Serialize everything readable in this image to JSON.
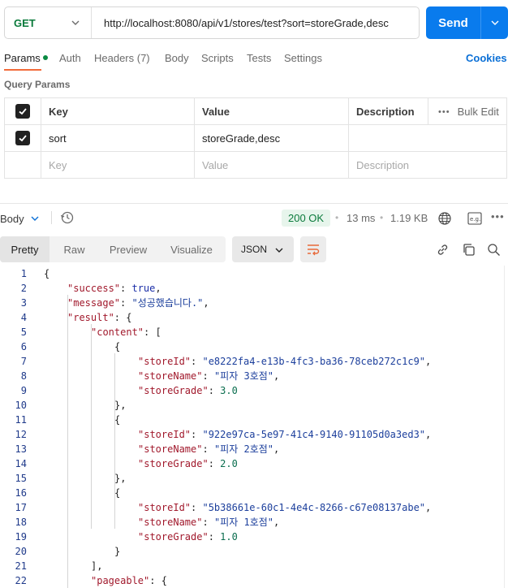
{
  "request": {
    "method": "GET",
    "url": "http://localhost:8080/api/v1/stores/test?sort=storeGrade,desc",
    "send_label": "Send"
  },
  "request_tabs": [
    "Params",
    "Auth",
    "Headers (7)",
    "Body",
    "Scripts",
    "Tests",
    "Settings"
  ],
  "cookies_label": "Cookies",
  "query_params": {
    "title": "Query Params",
    "headers": {
      "key": "Key",
      "value": "Value",
      "description": "Description",
      "bulk_edit": "Bulk Edit"
    },
    "rows": [
      {
        "key": "sort",
        "value": "storeGrade,desc",
        "description": ""
      }
    ],
    "placeholders": {
      "key": "Key",
      "value": "Value",
      "description": "Description"
    }
  },
  "response": {
    "body_label": "Body",
    "status": "200 OK",
    "time": "13 ms",
    "size": "1.19 KB",
    "format_tabs": [
      "Pretty",
      "Raw",
      "Preview",
      "Visualize"
    ],
    "format_selected": "JSON"
  },
  "icons": {
    "method_dropdown": "chevron-down-icon",
    "send_dropdown": "chevron-down-icon",
    "history": "history-icon",
    "globe": "globe-icon",
    "save_example": "save-example-icon",
    "more": "more-icon",
    "wrap": "wrap-lines-icon",
    "link": "link-icon",
    "copy": "copy-icon",
    "search": "search-icon"
  },
  "colors": {
    "send": "#097bed",
    "method_get": "#0a7a3b",
    "active_underline": "#f26b3a",
    "status_ok": "#0a7a3b",
    "json_key": "#a1192c",
    "json_string": "#1c3f9c",
    "json_number": "#0b6e4f"
  },
  "code_lines": [
    {
      "n": "1",
      "indent": 0,
      "t": [
        [
          "{",
          "p"
        ]
      ]
    },
    {
      "n": "2",
      "indent": 1,
      "t": [
        [
          "\"success\"",
          "k"
        ],
        [
          ": ",
          "p"
        ],
        [
          "true",
          "b"
        ],
        [
          ",",
          "p"
        ]
      ]
    },
    {
      "n": "3",
      "indent": 1,
      "t": [
        [
          "\"message\"",
          "k"
        ],
        [
          ": ",
          "p"
        ],
        [
          "\"성공했습니다.\"",
          "s"
        ],
        [
          ",",
          "p"
        ]
      ]
    },
    {
      "n": "4",
      "indent": 1,
      "t": [
        [
          "\"result\"",
          "k"
        ],
        [
          ": {",
          "p"
        ]
      ]
    },
    {
      "n": "5",
      "indent": 2,
      "t": [
        [
          "\"content\"",
          "k"
        ],
        [
          ": [",
          "p"
        ]
      ]
    },
    {
      "n": "6",
      "indent": 3,
      "t": [
        [
          "{",
          "p"
        ]
      ]
    },
    {
      "n": "7",
      "indent": 4,
      "t": [
        [
          "\"storeId\"",
          "k"
        ],
        [
          ": ",
          "p"
        ],
        [
          "\"e8222fa4-e13b-4fc3-ba36-78ceb272c1c9\"",
          "s"
        ],
        [
          ",",
          "p"
        ]
      ]
    },
    {
      "n": "8",
      "indent": 4,
      "t": [
        [
          "\"storeName\"",
          "k"
        ],
        [
          ": ",
          "p"
        ],
        [
          "\"피자 3호점\"",
          "s"
        ],
        [
          ",",
          "p"
        ]
      ]
    },
    {
      "n": "9",
      "indent": 4,
      "t": [
        [
          "\"storeGrade\"",
          "k"
        ],
        [
          ": ",
          "p"
        ],
        [
          "3.0",
          "n"
        ]
      ]
    },
    {
      "n": "10",
      "indent": 3,
      "t": [
        [
          "},",
          "p"
        ]
      ]
    },
    {
      "n": "11",
      "indent": 3,
      "t": [
        [
          "{",
          "p"
        ]
      ]
    },
    {
      "n": "12",
      "indent": 4,
      "t": [
        [
          "\"storeId\"",
          "k"
        ],
        [
          ": ",
          "p"
        ],
        [
          "\"922e97ca-5e97-41c4-9140-91105d0a3ed3\"",
          "s"
        ],
        [
          ",",
          "p"
        ]
      ]
    },
    {
      "n": "13",
      "indent": 4,
      "t": [
        [
          "\"storeName\"",
          "k"
        ],
        [
          ": ",
          "p"
        ],
        [
          "\"피자 2호점\"",
          "s"
        ],
        [
          ",",
          "p"
        ]
      ]
    },
    {
      "n": "14",
      "indent": 4,
      "t": [
        [
          "\"storeGrade\"",
          "k"
        ],
        [
          ": ",
          "p"
        ],
        [
          "2.0",
          "n"
        ]
      ]
    },
    {
      "n": "15",
      "indent": 3,
      "t": [
        [
          "},",
          "p"
        ]
      ]
    },
    {
      "n": "16",
      "indent": 3,
      "t": [
        [
          "{",
          "p"
        ]
      ]
    },
    {
      "n": "17",
      "indent": 4,
      "t": [
        [
          "\"storeId\"",
          "k"
        ],
        [
          ": ",
          "p"
        ],
        [
          "\"5b38661e-60c1-4e4c-8266-c67e08137abe\"",
          "s"
        ],
        [
          ",",
          "p"
        ]
      ]
    },
    {
      "n": "18",
      "indent": 4,
      "t": [
        [
          "\"storeName\"",
          "k"
        ],
        [
          ": ",
          "p"
        ],
        [
          "\"피자 1호점\"",
          "s"
        ],
        [
          ",",
          "p"
        ]
      ]
    },
    {
      "n": "19",
      "indent": 4,
      "t": [
        [
          "\"storeGrade\"",
          "k"
        ],
        [
          ": ",
          "p"
        ],
        [
          "1.0",
          "n"
        ]
      ]
    },
    {
      "n": "20",
      "indent": 3,
      "t": [
        [
          "}",
          "p"
        ]
      ]
    },
    {
      "n": "21",
      "indent": 2,
      "t": [
        [
          "],",
          "p"
        ]
      ]
    },
    {
      "n": "22",
      "indent": 2,
      "t": [
        [
          "\"pageable\"",
          "k"
        ],
        [
          ": {",
          "p"
        ]
      ]
    }
  ]
}
